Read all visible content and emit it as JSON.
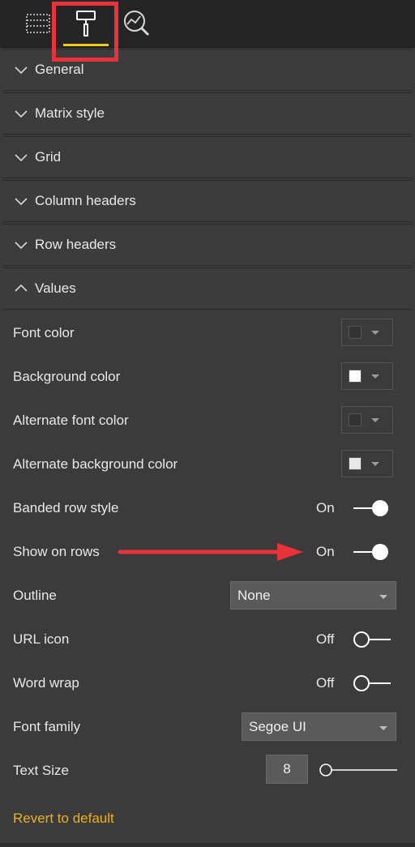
{
  "tabs": [
    {
      "icon": "fields-icon"
    },
    {
      "icon": "format-paint-roller-icon",
      "selected": true
    },
    {
      "icon": "analytics-icon"
    }
  ],
  "sections": [
    {
      "label": "General",
      "expanded": false
    },
    {
      "label": "Matrix style",
      "expanded": false
    },
    {
      "label": "Grid",
      "expanded": false
    },
    {
      "label": "Column headers",
      "expanded": false
    },
    {
      "label": "Row headers",
      "expanded": false
    },
    {
      "label": "Values",
      "expanded": true
    }
  ],
  "values": {
    "font_color": {
      "label": "Font color",
      "color": "#333333"
    },
    "background_color": {
      "label": "Background color",
      "color": "#ffffff"
    },
    "alternate_font_color": {
      "label": "Alternate font color",
      "color": "#333333"
    },
    "alternate_background_color": {
      "label": "Alternate background color",
      "color": "#e8e8e8"
    },
    "banded_row_style": {
      "label": "Banded row style",
      "state": "On"
    },
    "show_on_rows": {
      "label": "Show on rows",
      "state": "On"
    },
    "outline": {
      "label": "Outline",
      "value": "None"
    },
    "url_icon": {
      "label": "URL icon",
      "state": "Off"
    },
    "word_wrap": {
      "label": "Word wrap",
      "state": "Off"
    },
    "font_family": {
      "label": "Font family",
      "value": "Segoe UI"
    },
    "text_size": {
      "label": "Text Size",
      "value": "8"
    }
  },
  "revert_label": "Revert to default",
  "colors": {
    "accent": "#f2c811",
    "highlight_red": "#e8333a",
    "revert": "#e8b21d"
  }
}
